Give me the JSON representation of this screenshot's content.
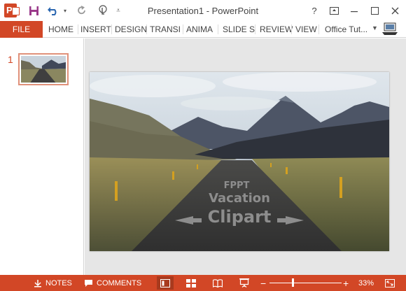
{
  "window": {
    "title": "Presentation1 - PowerPoint",
    "app_icon_letter": "P",
    "controls": [
      "help-icon",
      "ribbon-display-icon",
      "minimize-icon",
      "maximize-icon",
      "close-icon"
    ]
  },
  "quick_access": [
    "save-icon",
    "undo-icon",
    "redo-icon",
    "touch-mode-icon",
    "customize-icon"
  ],
  "ribbon": {
    "file": "FILE",
    "tabs": [
      "HOME",
      "INSERT",
      "DESIGN",
      "TRANSI",
      "ANIMA",
      "SLIDE S",
      "REVIEW",
      "VIEW"
    ],
    "user": "Office Tut..."
  },
  "thumbnails": [
    {
      "number": "1"
    }
  ],
  "slide": {
    "road_text": [
      "FPPT",
      "Vacation",
      "Clipart"
    ]
  },
  "status": {
    "notes": "NOTES",
    "comments": "COMMENTS",
    "zoom_minus": "−",
    "zoom_plus": "+",
    "zoom": "33%",
    "zoom_fraction": 0.33
  },
  "colors": {
    "accent": "#D24726",
    "status_active": "#A83A1E",
    "thumb_border": "#E0917A"
  }
}
